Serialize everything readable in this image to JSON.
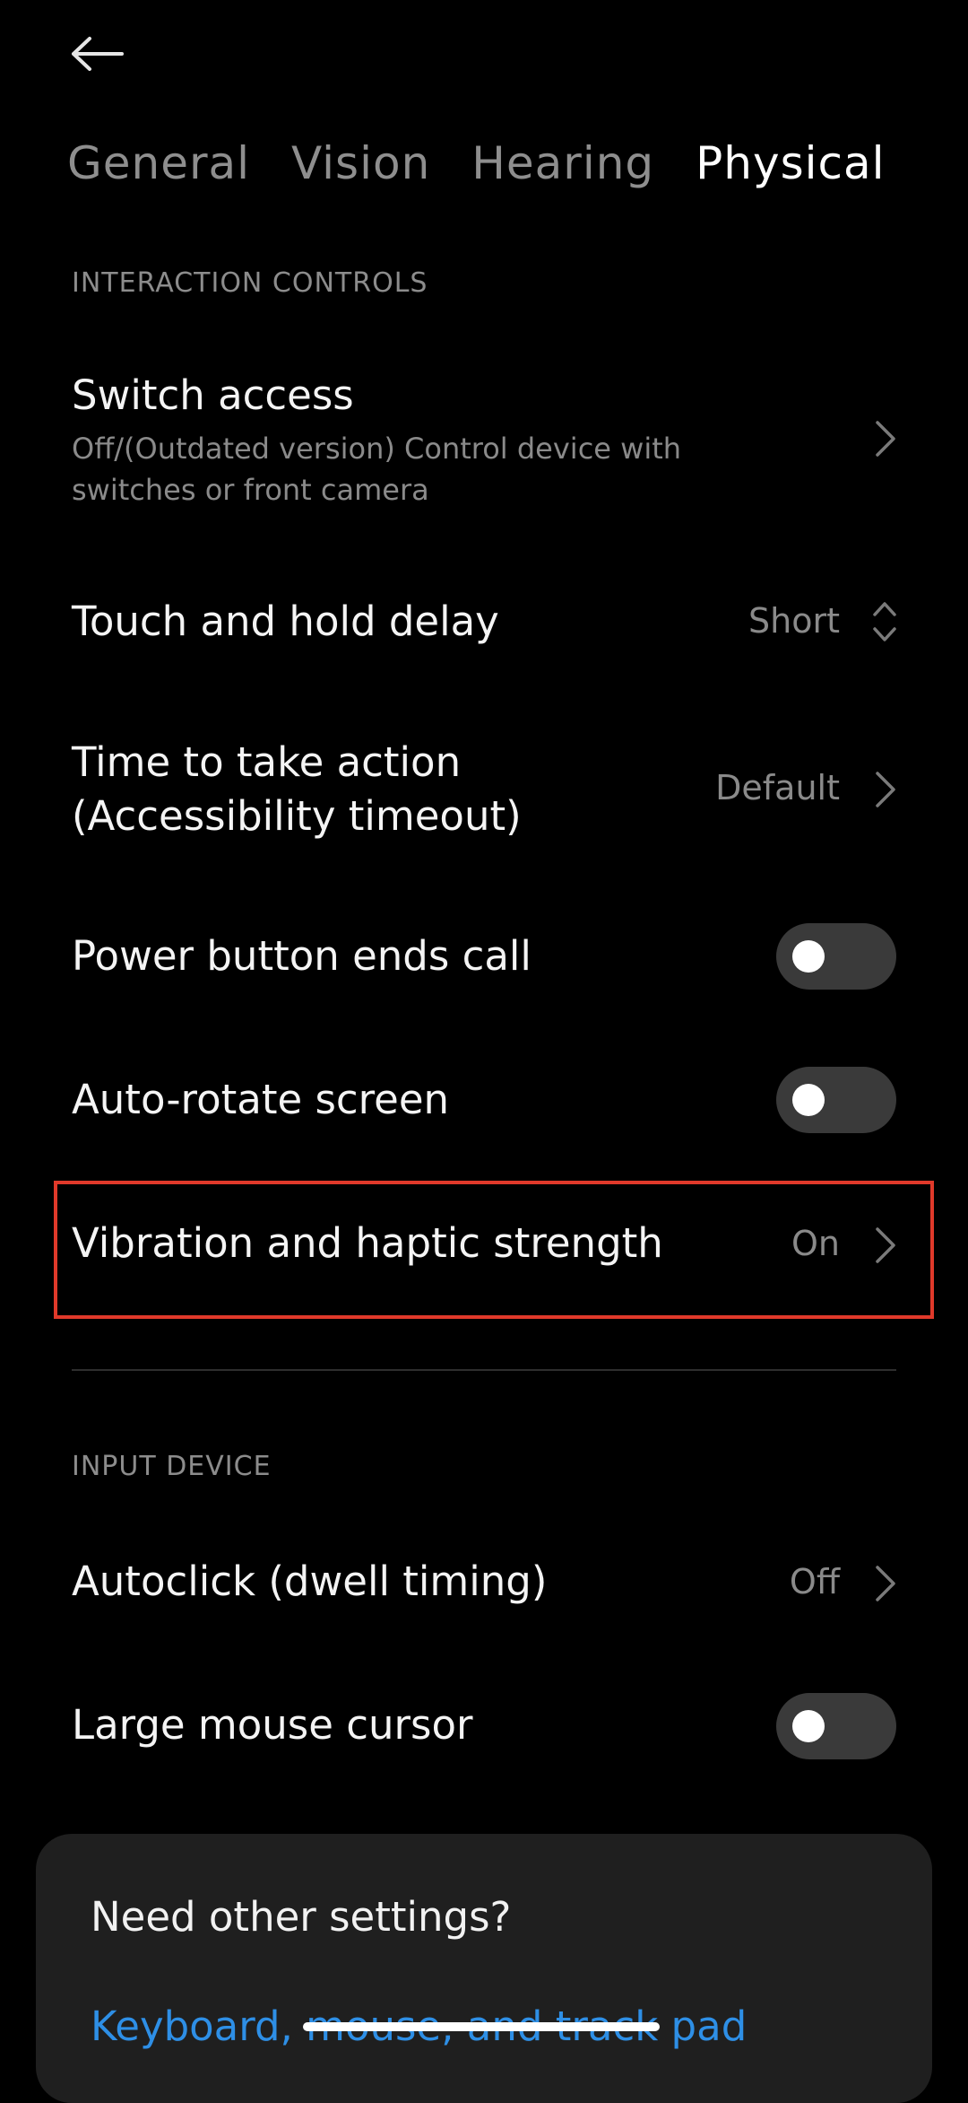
{
  "header": {
    "back_icon": "arrow-left-icon"
  },
  "tabs": [
    {
      "label": "General",
      "active": false
    },
    {
      "label": "Vision",
      "active": false
    },
    {
      "label": "Hearing",
      "active": false
    },
    {
      "label": "Physical",
      "active": true
    }
  ],
  "sections": {
    "interaction": {
      "title": "INTERACTION CONTROLS",
      "switch_access": {
        "title": "Switch access",
        "subtitle": "Off/(Outdated version) Control device with switches or front camera"
      },
      "touch_hold": {
        "title": "Touch and hold delay",
        "value": "Short"
      },
      "time_action": {
        "title_line1": "Time to take action",
        "title_line2": "(Accessibility timeout)",
        "value": "Default"
      },
      "power_button": {
        "title": "Power button ends call",
        "on": false
      },
      "auto_rotate": {
        "title": "Auto-rotate screen",
        "on": false
      },
      "vibration": {
        "title": "Vibration and haptic strength",
        "value": "On"
      }
    },
    "input": {
      "title": "INPUT DEVICE",
      "autoclick": {
        "title": "Autoclick (dwell timing)",
        "value": "Off"
      },
      "large_cursor": {
        "title": "Large mouse cursor",
        "on": false
      }
    }
  },
  "card": {
    "title": "Need other settings?",
    "link": "Keyboard, mouse, and track pad"
  },
  "colors": {
    "background": "#000000",
    "accent_link": "#2e8fe6",
    "highlight": "#e0392a"
  }
}
